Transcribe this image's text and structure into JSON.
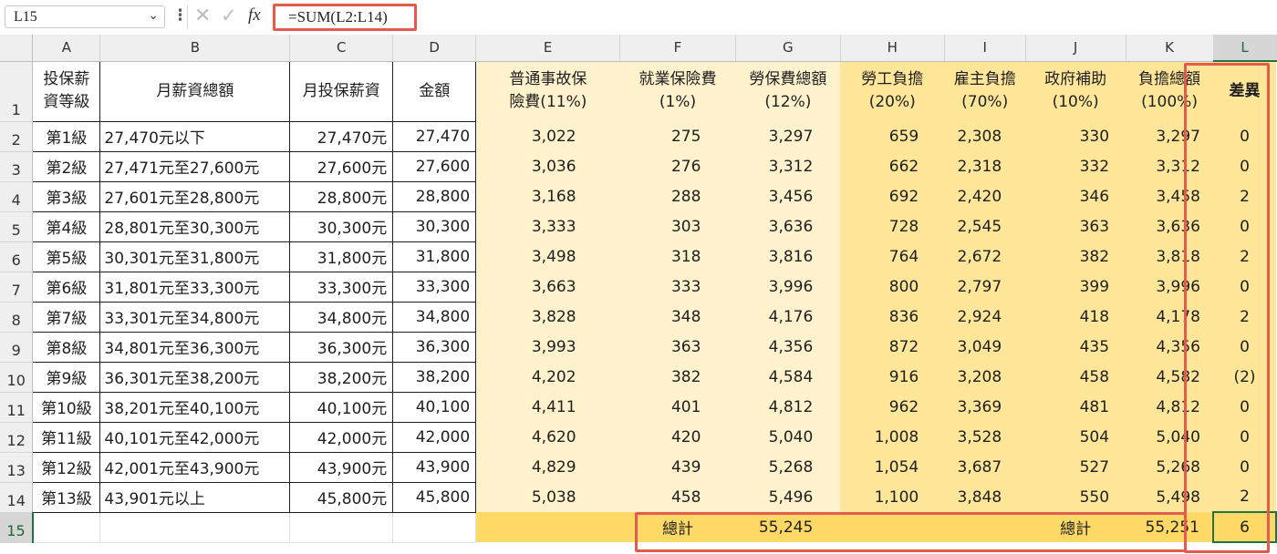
{
  "formula_bar": {
    "name_box": "L15",
    "name_dropdown_icon": "chevron-down-icon",
    "more_icon": "vertical-dots-icon",
    "cancel_icon": "cross-icon",
    "enter_icon": "check-icon",
    "fx_label": "fx",
    "formula": "=SUM(L2:L14)"
  },
  "columns": [
    "A",
    "B",
    "C",
    "D",
    "E",
    "F",
    "G",
    "H",
    "I",
    "J",
    "K",
    "L"
  ],
  "selected_column": "L",
  "row_numbers": [
    "1",
    "2",
    "3",
    "4",
    "5",
    "6",
    "7",
    "8",
    "9",
    "10",
    "11",
    "12",
    "13",
    "14",
    "15"
  ],
  "selected_row": "15",
  "header": {
    "A": "投保薪資等級",
    "B": "月薪資總額",
    "C": "月投保薪資",
    "D": "金額",
    "E": "普通事故保險費(11%)",
    "F": "就業保險費(1%)",
    "G": "勞保費總額(12%)",
    "H": "勞工負擔(20%)",
    "I": "雇主負擔(70%)",
    "J": "政府補助(10%)",
    "K": "負擔總額(100%)",
    "L": "差異"
  },
  "rows": [
    [
      "第1級",
      "27,470元以下",
      "27,470元",
      "27,470",
      "3,022",
      "275",
      "3,297",
      "659",
      "2,308",
      "330",
      "3,297",
      "0"
    ],
    [
      "第2級",
      "27,471元至27,600元",
      "27,600元",
      "27,600",
      "3,036",
      "276",
      "3,312",
      "662",
      "2,318",
      "332",
      "3,312",
      "0"
    ],
    [
      "第3級",
      "27,601元至28,800元",
      "28,800元",
      "28,800",
      "3,168",
      "288",
      "3,456",
      "692",
      "2,420",
      "346",
      "3,458",
      "2"
    ],
    [
      "第4級",
      "28,801元至30,300元",
      "30,300元",
      "30,300",
      "3,333",
      "303",
      "3,636",
      "728",
      "2,545",
      "363",
      "3,636",
      "0"
    ],
    [
      "第5級",
      "30,301元至31,800元",
      "31,800元",
      "31,800",
      "3,498",
      "318",
      "3,816",
      "764",
      "2,672",
      "382",
      "3,818",
      "2"
    ],
    [
      "第6級",
      "31,801元至33,300元",
      "33,300元",
      "33,300",
      "3,663",
      "333",
      "3,996",
      "800",
      "2,797",
      "399",
      "3,996",
      "0"
    ],
    [
      "第7級",
      "33,301元至34,800元",
      "34,800元",
      "34,800",
      "3,828",
      "348",
      "4,176",
      "836",
      "2,924",
      "418",
      "4,178",
      "2"
    ],
    [
      "第8級",
      "34,801元至36,300元",
      "36,300元",
      "36,300",
      "3,993",
      "363",
      "4,356",
      "872",
      "3,049",
      "435",
      "4,356",
      "0"
    ],
    [
      "第9級",
      "36,301元至38,200元",
      "38,200元",
      "38,200",
      "4,202",
      "382",
      "4,584",
      "916",
      "3,208",
      "458",
      "4,582",
      "(2)"
    ],
    [
      "第10級",
      "38,201元至40,100元",
      "40,100元",
      "40,100",
      "4,411",
      "401",
      "4,812",
      "962",
      "3,369",
      "481",
      "4,812",
      "0"
    ],
    [
      "第11級",
      "40,101元至42,000元",
      "42,000元",
      "42,000",
      "4,620",
      "420",
      "5,040",
      "1,008",
      "3,528",
      "504",
      "5,040",
      "0"
    ],
    [
      "第12級",
      "42,001元至43,900元",
      "43,900元",
      "43,900",
      "4,829",
      "439",
      "5,268",
      "1,054",
      "3,687",
      "527",
      "5,268",
      "0"
    ],
    [
      "第13級",
      "43,901元以上",
      "45,800元",
      "45,800",
      "5,038",
      "458",
      "5,496",
      "1,100",
      "3,848",
      "550",
      "5,498",
      "2"
    ]
  ],
  "totals": {
    "label_1": "總計",
    "value_g": "55,245",
    "label_2": "總計",
    "value_k": "55,251",
    "value_l": "6"
  },
  "colors": {
    "light_fill": "#fff2cc",
    "dark_fill": "#ffe699",
    "total_fill": "#ffd966",
    "highlight_box": "#e35b4f",
    "negative_text": "#c00000",
    "selection": "#217346"
  }
}
